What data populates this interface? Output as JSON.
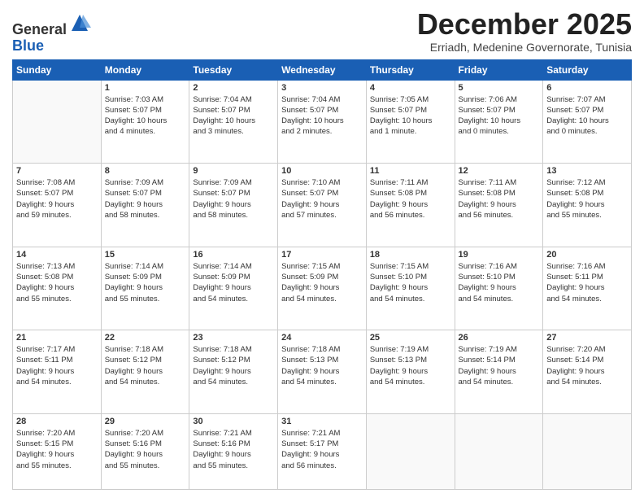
{
  "logo": {
    "general": "General",
    "blue": "Blue"
  },
  "title": "December 2025",
  "location": "Erriadh, Medenine Governorate, Tunisia",
  "days_of_week": [
    "Sunday",
    "Monday",
    "Tuesday",
    "Wednesday",
    "Thursday",
    "Friday",
    "Saturday"
  ],
  "weeks": [
    [
      {
        "day": "",
        "info": ""
      },
      {
        "day": "1",
        "info": "Sunrise: 7:03 AM\nSunset: 5:07 PM\nDaylight: 10 hours\nand 4 minutes."
      },
      {
        "day": "2",
        "info": "Sunrise: 7:04 AM\nSunset: 5:07 PM\nDaylight: 10 hours\nand 3 minutes."
      },
      {
        "day": "3",
        "info": "Sunrise: 7:04 AM\nSunset: 5:07 PM\nDaylight: 10 hours\nand 2 minutes."
      },
      {
        "day": "4",
        "info": "Sunrise: 7:05 AM\nSunset: 5:07 PM\nDaylight: 10 hours\nand 1 minute."
      },
      {
        "day": "5",
        "info": "Sunrise: 7:06 AM\nSunset: 5:07 PM\nDaylight: 10 hours\nand 0 minutes."
      },
      {
        "day": "6",
        "info": "Sunrise: 7:07 AM\nSunset: 5:07 PM\nDaylight: 10 hours\nand 0 minutes."
      }
    ],
    [
      {
        "day": "7",
        "info": "Sunrise: 7:08 AM\nSunset: 5:07 PM\nDaylight: 9 hours\nand 59 minutes."
      },
      {
        "day": "8",
        "info": "Sunrise: 7:09 AM\nSunset: 5:07 PM\nDaylight: 9 hours\nand 58 minutes."
      },
      {
        "day": "9",
        "info": "Sunrise: 7:09 AM\nSunset: 5:07 PM\nDaylight: 9 hours\nand 58 minutes."
      },
      {
        "day": "10",
        "info": "Sunrise: 7:10 AM\nSunset: 5:07 PM\nDaylight: 9 hours\nand 57 minutes."
      },
      {
        "day": "11",
        "info": "Sunrise: 7:11 AM\nSunset: 5:08 PM\nDaylight: 9 hours\nand 56 minutes."
      },
      {
        "day": "12",
        "info": "Sunrise: 7:11 AM\nSunset: 5:08 PM\nDaylight: 9 hours\nand 56 minutes."
      },
      {
        "day": "13",
        "info": "Sunrise: 7:12 AM\nSunset: 5:08 PM\nDaylight: 9 hours\nand 55 minutes."
      }
    ],
    [
      {
        "day": "14",
        "info": "Sunrise: 7:13 AM\nSunset: 5:08 PM\nDaylight: 9 hours\nand 55 minutes."
      },
      {
        "day": "15",
        "info": "Sunrise: 7:14 AM\nSunset: 5:09 PM\nDaylight: 9 hours\nand 55 minutes."
      },
      {
        "day": "16",
        "info": "Sunrise: 7:14 AM\nSunset: 5:09 PM\nDaylight: 9 hours\nand 54 minutes."
      },
      {
        "day": "17",
        "info": "Sunrise: 7:15 AM\nSunset: 5:09 PM\nDaylight: 9 hours\nand 54 minutes."
      },
      {
        "day": "18",
        "info": "Sunrise: 7:15 AM\nSunset: 5:10 PM\nDaylight: 9 hours\nand 54 minutes."
      },
      {
        "day": "19",
        "info": "Sunrise: 7:16 AM\nSunset: 5:10 PM\nDaylight: 9 hours\nand 54 minutes."
      },
      {
        "day": "20",
        "info": "Sunrise: 7:16 AM\nSunset: 5:11 PM\nDaylight: 9 hours\nand 54 minutes."
      }
    ],
    [
      {
        "day": "21",
        "info": "Sunrise: 7:17 AM\nSunset: 5:11 PM\nDaylight: 9 hours\nand 54 minutes."
      },
      {
        "day": "22",
        "info": "Sunrise: 7:18 AM\nSunset: 5:12 PM\nDaylight: 9 hours\nand 54 minutes."
      },
      {
        "day": "23",
        "info": "Sunrise: 7:18 AM\nSunset: 5:12 PM\nDaylight: 9 hours\nand 54 minutes."
      },
      {
        "day": "24",
        "info": "Sunrise: 7:18 AM\nSunset: 5:13 PM\nDaylight: 9 hours\nand 54 minutes."
      },
      {
        "day": "25",
        "info": "Sunrise: 7:19 AM\nSunset: 5:13 PM\nDaylight: 9 hours\nand 54 minutes."
      },
      {
        "day": "26",
        "info": "Sunrise: 7:19 AM\nSunset: 5:14 PM\nDaylight: 9 hours\nand 54 minutes."
      },
      {
        "day": "27",
        "info": "Sunrise: 7:20 AM\nSunset: 5:14 PM\nDaylight: 9 hours\nand 54 minutes."
      }
    ],
    [
      {
        "day": "28",
        "info": "Sunrise: 7:20 AM\nSunset: 5:15 PM\nDaylight: 9 hours\nand 55 minutes."
      },
      {
        "day": "29",
        "info": "Sunrise: 7:20 AM\nSunset: 5:16 PM\nDaylight: 9 hours\nand 55 minutes."
      },
      {
        "day": "30",
        "info": "Sunrise: 7:21 AM\nSunset: 5:16 PM\nDaylight: 9 hours\nand 55 minutes."
      },
      {
        "day": "31",
        "info": "Sunrise: 7:21 AM\nSunset: 5:17 PM\nDaylight: 9 hours\nand 56 minutes."
      },
      {
        "day": "",
        "info": ""
      },
      {
        "day": "",
        "info": ""
      },
      {
        "day": "",
        "info": ""
      }
    ]
  ]
}
